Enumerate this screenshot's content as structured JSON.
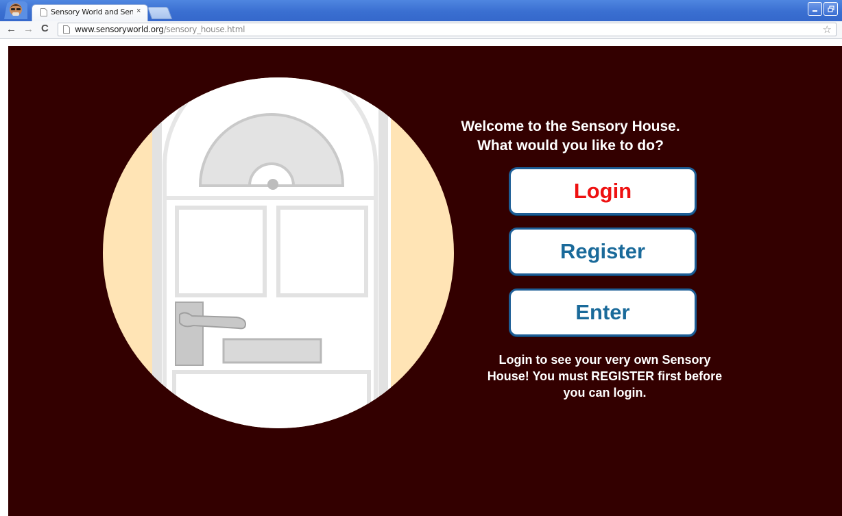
{
  "browser": {
    "tab_title": "Sensory World and Sensory H",
    "tab_close": "×",
    "url_host": "www.sensoryworld.org",
    "url_path": "/sensory_house.html",
    "icons": {
      "back": "back-arrow-icon",
      "forward": "forward-arrow-icon",
      "reload": "reload-icon",
      "bookmark": "star-icon"
    }
  },
  "page": {
    "welcome_line1": "Welcome to the Sensory House.",
    "welcome_line2": "What would you like to do?",
    "buttons": {
      "login": "Login",
      "register": "Register",
      "enter": "Enter"
    },
    "info_line1": "Login to see your very own Sensory",
    "info_line2": "House! You must REGISTER first before",
    "info_line3": "you can login."
  },
  "colors": {
    "background": "#330000",
    "login_text": "#ee1111",
    "button_text": "#1a6a9a",
    "button_border": "#1d5e96",
    "circle_accent": "#ffe4b5"
  }
}
